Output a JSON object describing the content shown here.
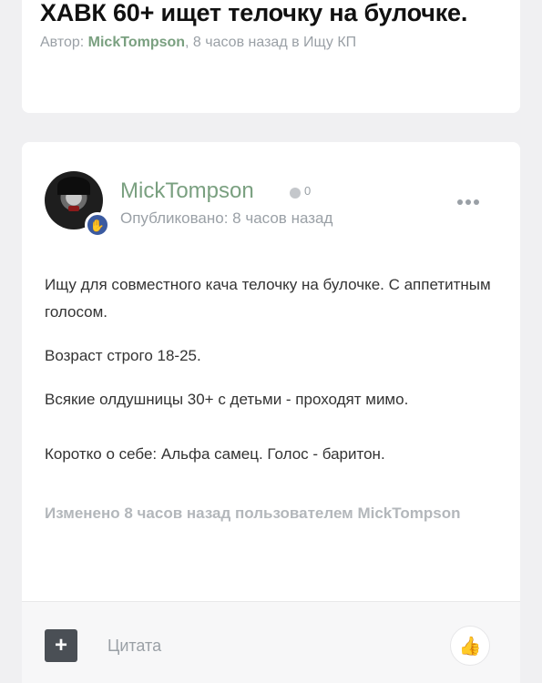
{
  "topic": {
    "title": "ХАВК 60+ ищет телочку на булочке.",
    "meta_prefix": "Автор: ",
    "author": "MickTompson",
    "meta_suffix": ", 8 часов назад в Ищу КП"
  },
  "post": {
    "author": "MickTompson",
    "reputation": "0",
    "posted": "Опубликовано: 8 часов назад",
    "paragraphs": [
      "Ищу для совместного кача телочку на булочке. С аппетитным голосом.",
      "Возраст строго 18-25.",
      "Всякие олдушницы 30+ с детьми - проходят мимо.",
      "Коротко о себе: Альфа самец. Голос - баритон."
    ],
    "edited": "Изменено 8 часов назад пользователем MickTompson"
  },
  "footer": {
    "plus_label": "+",
    "quote_label": "Цитата"
  },
  "icons": {
    "badge": "hand-icon",
    "more": "more-options-icon",
    "like": "thumbs-up-icon"
  },
  "colors": {
    "accent": "#7aa080",
    "muted": "#9aa0a6",
    "badge": "#3a5aa0"
  }
}
